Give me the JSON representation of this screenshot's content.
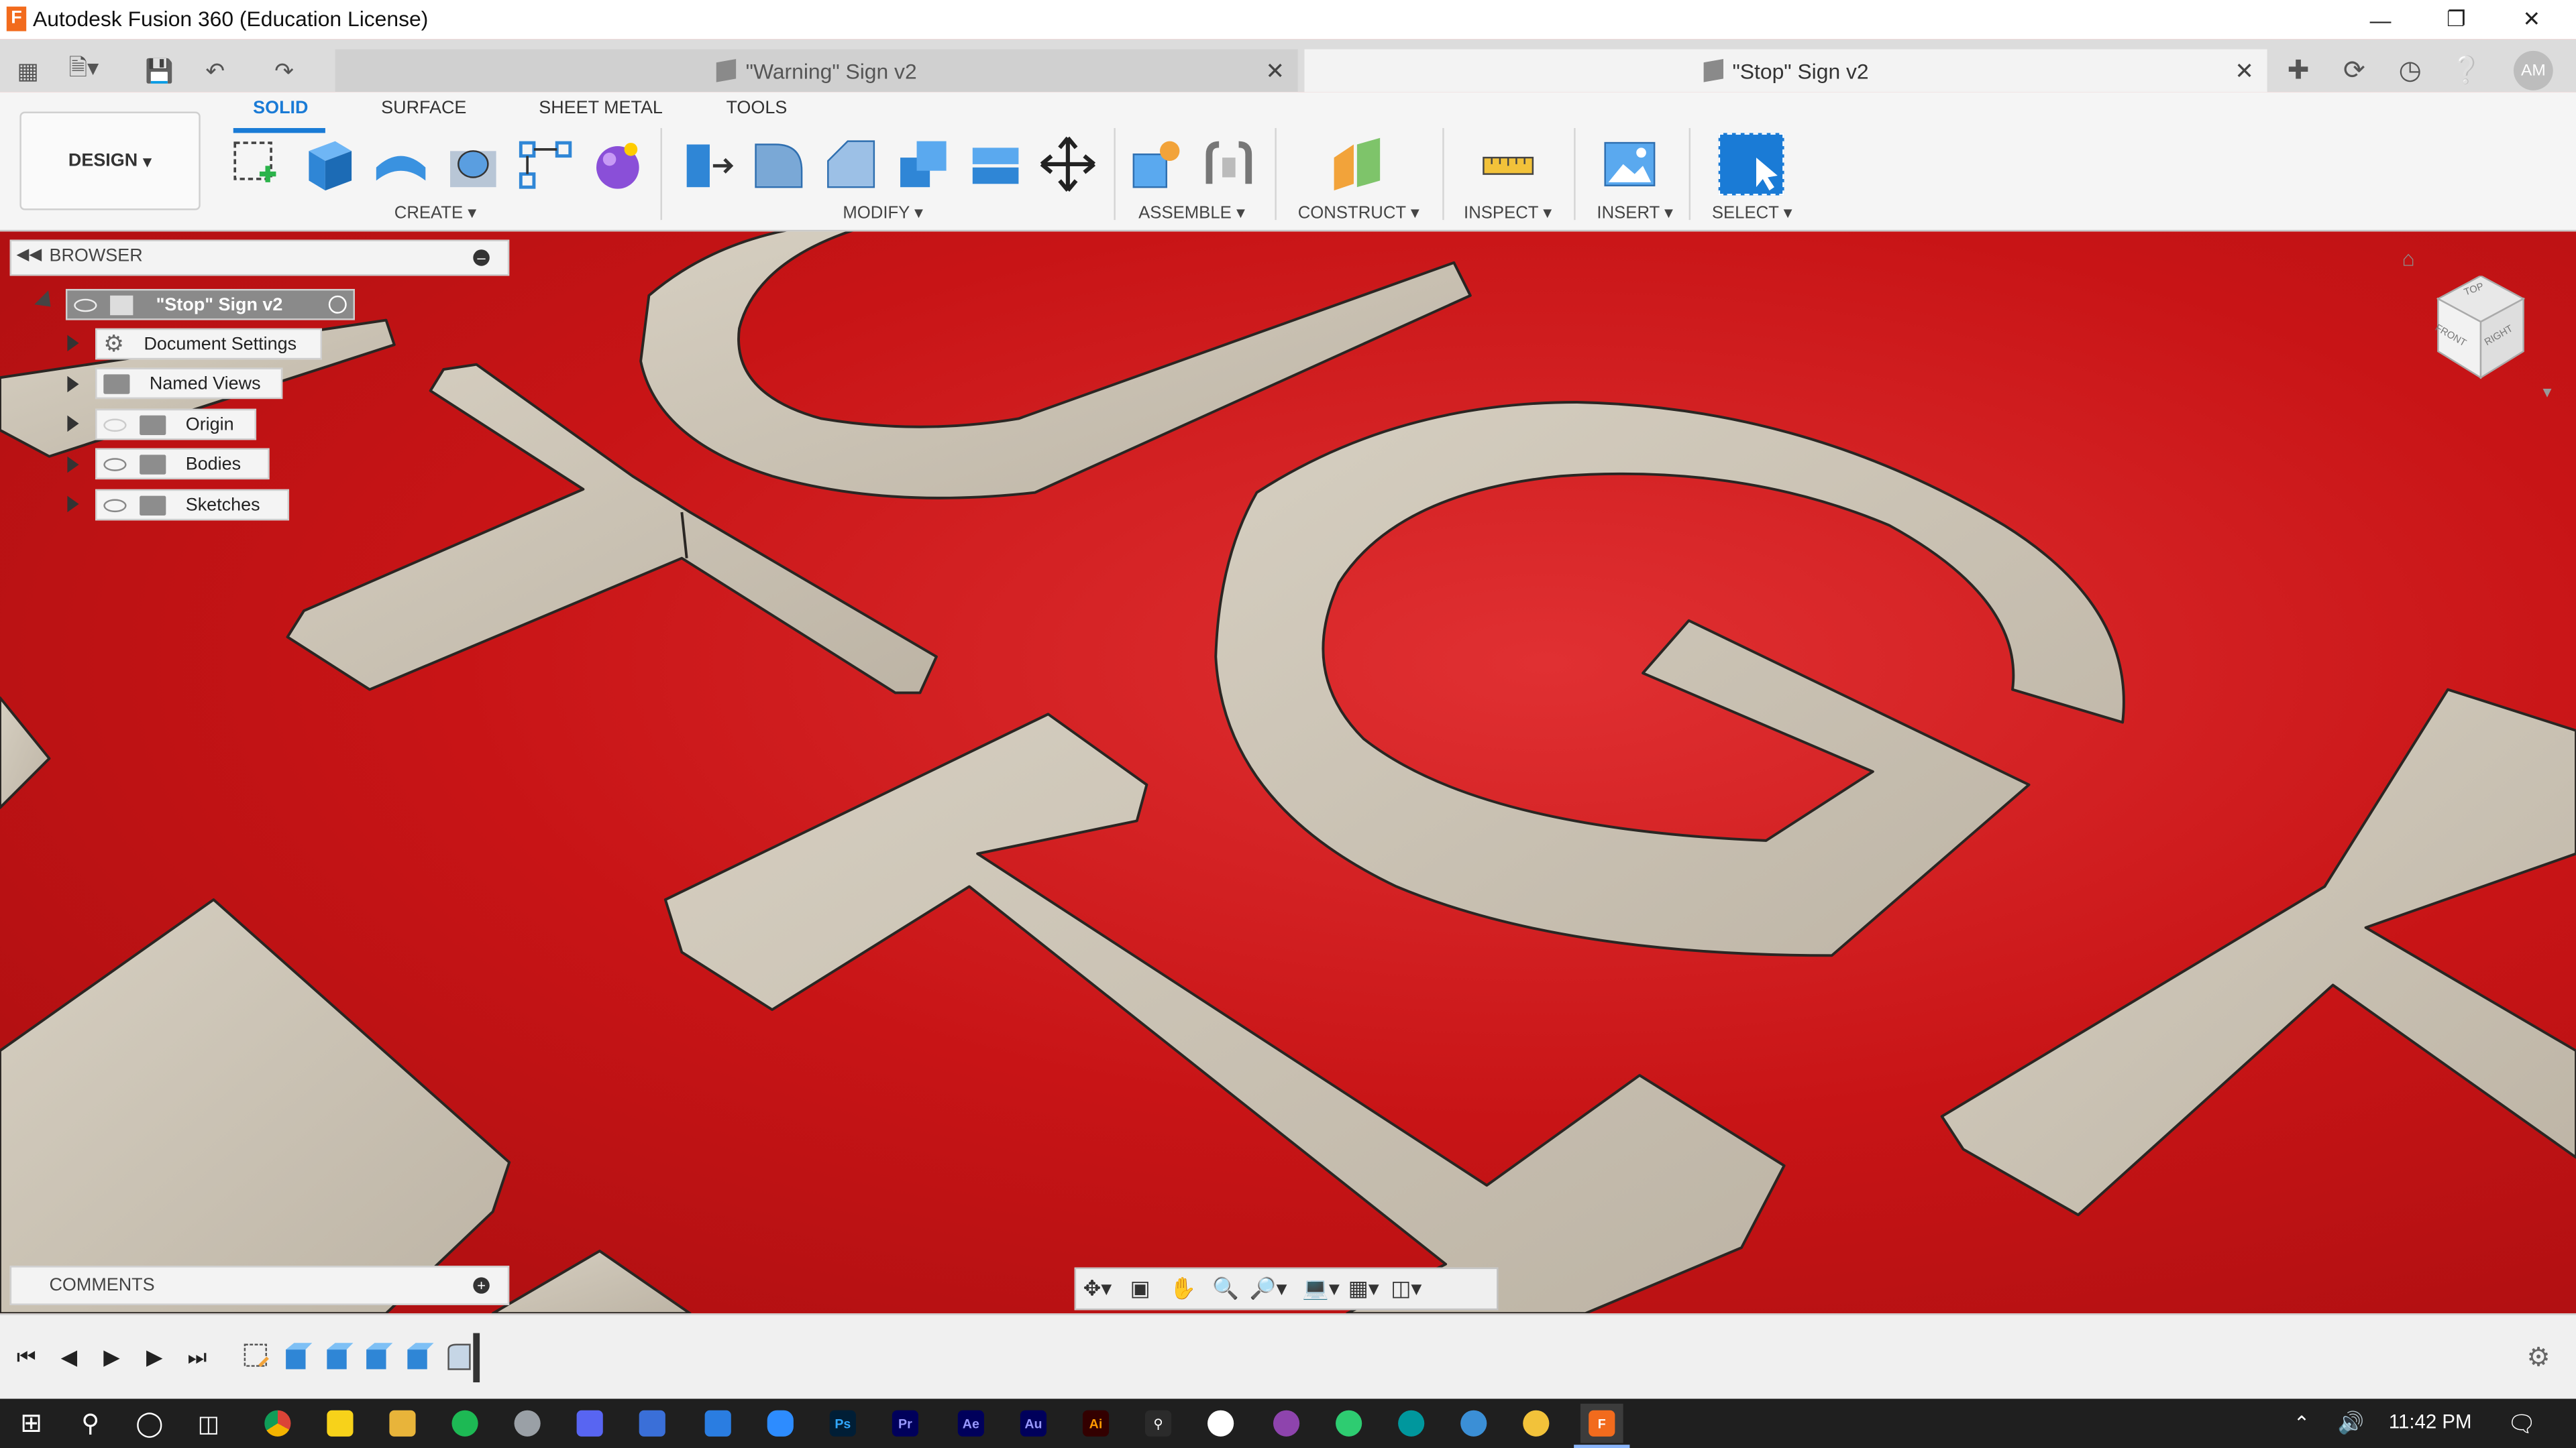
{
  "window": {
    "title": "Autodesk Fusion 360 (Education License)",
    "logo": "F"
  },
  "tabs": [
    {
      "label": "\"Warning\" Sign v2",
      "active": false
    },
    {
      "label": "\"Stop\" Sign v2",
      "active": true
    }
  ],
  "user": {
    "initials": "AM"
  },
  "toolbar": {
    "design_label": "DESIGN",
    "workspace_tabs": [
      "SOLID",
      "SURFACE",
      "SHEET METAL",
      "TOOLS"
    ],
    "groups": [
      "CREATE",
      "MODIFY",
      "ASSEMBLE",
      "CONSTRUCT",
      "INSPECT",
      "INSERT",
      "SELECT"
    ]
  },
  "browser": {
    "title": "BROWSER",
    "root": "\"Stop\" Sign v2",
    "items": [
      "Document Settings",
      "Named Views",
      "Origin",
      "Bodies",
      "Sketches"
    ]
  },
  "comments": {
    "title": "COMMENTS"
  },
  "viewcube": {
    "top": "TOP",
    "front": "FRONT",
    "right": "RIGHT"
  },
  "taskbar": {
    "time": "11:42 PM",
    "apps": [
      "Ps",
      "Pr",
      "Ae",
      "Au",
      "Ai"
    ]
  },
  "colors": {
    "accent": "#1a7bd6",
    "viewport": "#c81416",
    "letters": "#cbc3b5"
  }
}
